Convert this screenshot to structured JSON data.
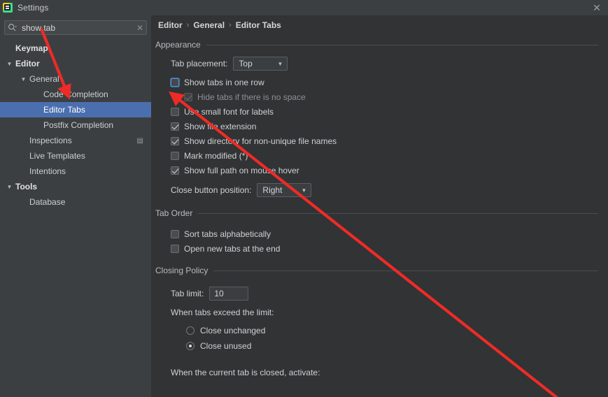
{
  "window": {
    "title": "Settings",
    "app_icon": "intellij-app-icon",
    "close_label": "✕"
  },
  "search": {
    "value": "show tab",
    "placeholder": "Search settings",
    "icon": "search-icon",
    "clear_label": "✕"
  },
  "sidebar": {
    "items": [
      {
        "label": "Keymap",
        "indent": 0,
        "bold": true,
        "twisty": "",
        "selected": false,
        "badge": ""
      },
      {
        "label": "Editor",
        "indent": 0,
        "bold": true,
        "twisty": "▼",
        "selected": false,
        "badge": ""
      },
      {
        "label": "General",
        "indent": 1,
        "bold": false,
        "twisty": "▼",
        "selected": false,
        "badge": ""
      },
      {
        "label": "Code Completion",
        "indent": 2,
        "bold": false,
        "twisty": "",
        "selected": false,
        "badge": ""
      },
      {
        "label": "Editor Tabs",
        "indent": 2,
        "bold": false,
        "twisty": "",
        "selected": true,
        "badge": ""
      },
      {
        "label": "Postfix Completion",
        "indent": 2,
        "bold": false,
        "twisty": "",
        "selected": false,
        "badge": ""
      },
      {
        "label": "Inspections",
        "indent": 1,
        "bold": false,
        "twisty": "",
        "selected": false,
        "badge": "▤"
      },
      {
        "label": "Live Templates",
        "indent": 1,
        "bold": false,
        "twisty": "",
        "selected": false,
        "badge": ""
      },
      {
        "label": "Intentions",
        "indent": 1,
        "bold": false,
        "twisty": "",
        "selected": false,
        "badge": ""
      },
      {
        "label": "Tools",
        "indent": 0,
        "bold": true,
        "twisty": "▼",
        "selected": false,
        "badge": ""
      },
      {
        "label": "Database",
        "indent": 1,
        "bold": false,
        "twisty": "",
        "selected": false,
        "badge": ""
      }
    ]
  },
  "breadcrumb": {
    "items": [
      "Editor",
      "General",
      "Editor Tabs"
    ],
    "separator": "›"
  },
  "appearance": {
    "title": "Appearance",
    "tab_placement_label": "Tab placement:",
    "tab_placement_value": "Top",
    "close_button_label": "Close button position:",
    "close_button_value": "Right",
    "dropdown_arrow": "▼",
    "checkboxes": [
      {
        "label": "Show tabs in one row",
        "checked": false,
        "disabled": false,
        "indent": false,
        "focused": true
      },
      {
        "label": "Hide tabs if there is no space",
        "checked": true,
        "disabled": true,
        "indent": true,
        "focused": false
      },
      {
        "label": "Use small font for labels",
        "checked": false,
        "disabled": false,
        "indent": false,
        "focused": false
      },
      {
        "label": "Show file extension",
        "checked": true,
        "disabled": false,
        "indent": false,
        "focused": false
      },
      {
        "label": "Show directory for non-unique file names",
        "checked": true,
        "disabled": false,
        "indent": false,
        "focused": false
      },
      {
        "label": "Mark modified (*)",
        "checked": false,
        "disabled": false,
        "indent": false,
        "focused": false
      },
      {
        "label": "Show full path on mouse hover",
        "checked": true,
        "disabled": false,
        "indent": false,
        "focused": false
      }
    ]
  },
  "tab_order": {
    "title": "Tab Order",
    "checkboxes": [
      {
        "label": "Sort tabs alphabetically",
        "checked": false
      },
      {
        "label": "Open new tabs at the end",
        "checked": false
      }
    ]
  },
  "closing_policy": {
    "title": "Closing Policy",
    "tab_limit_label": "Tab limit:",
    "tab_limit_value": "10",
    "exceed_label": "When tabs exceed the limit:",
    "radios": [
      {
        "label": "Close unchanged",
        "selected": false
      },
      {
        "label": "Close unused",
        "selected": true
      }
    ],
    "activate_label": "When the current tab is closed, activate:"
  },
  "annotations": {
    "arrow_color": "#ee2b26",
    "arrow_1_target": "Code Completion",
    "arrow_2_target": "Show tabs in one row checkbox"
  }
}
